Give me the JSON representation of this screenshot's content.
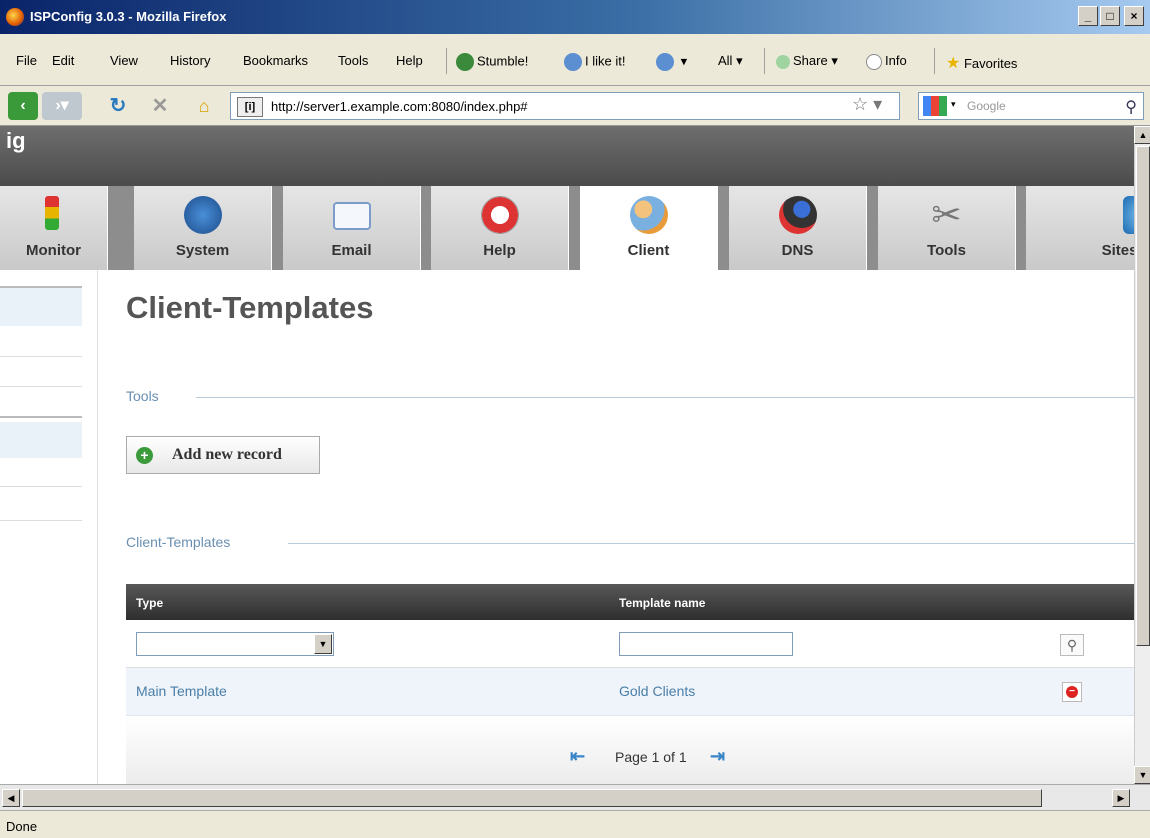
{
  "window": {
    "title": "ISPConfig 3.0.3 - Mozilla Firefox",
    "min": "_",
    "max": "□",
    "close": "×"
  },
  "menu": {
    "items": [
      "File",
      "Edit",
      "View",
      "History",
      "Bookmarks",
      "Tools",
      "Help"
    ],
    "stumble": "Stumble!",
    "ilike": "I like it!",
    "all": "All",
    "share": "Share",
    "info": "Info",
    "favorites": "Favorites"
  },
  "nav": {
    "url": "http://server1.example.com:8080/index.php#",
    "search_placeholder": "Google"
  },
  "app": {
    "tabs": [
      {
        "label": "Monitor"
      },
      {
        "label": "System"
      },
      {
        "label": "Email"
      },
      {
        "label": "Help"
      },
      {
        "label": "Client"
      },
      {
        "label": "DNS"
      },
      {
        "label": "Tools"
      },
      {
        "label": "Sites"
      }
    ],
    "page_title": "Client-Templates",
    "tools_section": "Tools",
    "add_button": "Add new record",
    "list_section": "Client-Templates",
    "table": {
      "headers": [
        "Type",
        "Template name"
      ],
      "rows": [
        {
          "type": "Main Template",
          "name": "Gold Clients"
        }
      ]
    },
    "pager": "Page 1 of 1"
  },
  "status": "Done"
}
